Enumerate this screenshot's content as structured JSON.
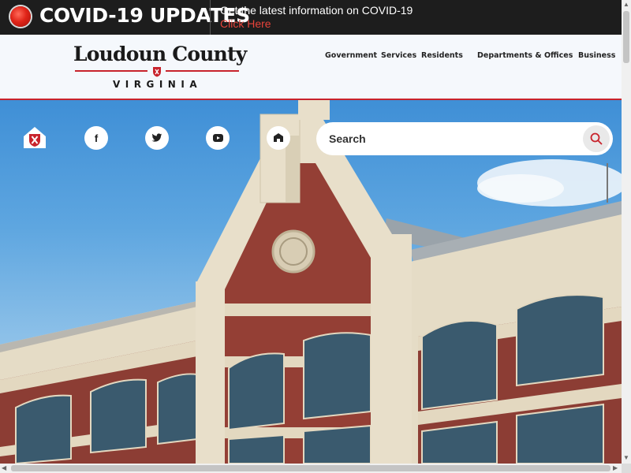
{
  "covid": {
    "title": "COVID-19 UPDATES",
    "info": "Get the latest information on COVID-19",
    "link": "Click Here"
  },
  "logo": {
    "name": "Loudoun County",
    "subtitle": "VIRGINIA"
  },
  "nav": {
    "items": [
      "Government",
      "Services",
      "Residents",
      "Departments & Offices",
      "Business"
    ]
  },
  "social": {
    "facebook": "f",
    "icons": [
      "home-shield-icon",
      "facebook-icon",
      "twitter-icon",
      "youtube-icon",
      "megaphone-icon",
      "search-icon"
    ]
  },
  "search": {
    "placeholder": "Search",
    "value": ""
  },
  "colors": {
    "brand_red": "#c8232c",
    "banner_bg": "#1d1d1d",
    "header_bg": "#f5f8fc",
    "link_red": "#e8433a"
  }
}
